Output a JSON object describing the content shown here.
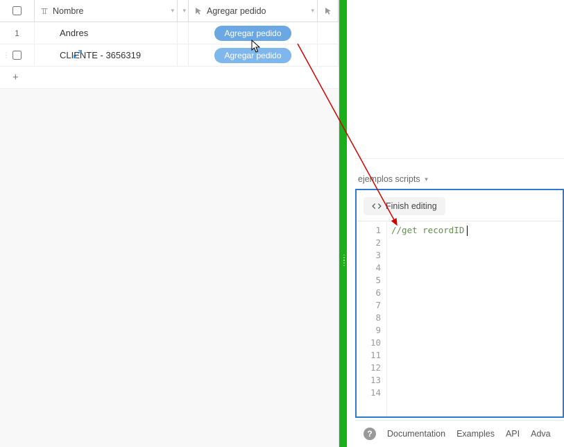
{
  "table": {
    "columns": {
      "nombre": "Nombre",
      "agregar": "Agregar pedido"
    },
    "rows": [
      {
        "num": "1",
        "nombre": "Andres",
        "button": "Agregar pedido",
        "expanded": false
      },
      {
        "num": "",
        "nombre": "CLIENTE - 3656319",
        "button": "Agregar pedido",
        "expanded": true
      }
    ],
    "add": "+"
  },
  "script": {
    "title": "ejemplos scripts",
    "finish_button": "Finish editing",
    "code": {
      "line1": "//get recordID"
    },
    "line_numbers": [
      "1",
      "2",
      "3",
      "4",
      "5",
      "6",
      "7",
      "8",
      "9",
      "10",
      "11",
      "12",
      "13",
      "14"
    ]
  },
  "footer": {
    "help": "?",
    "documentation": "Documentation",
    "examples": "Examples",
    "api": "API",
    "advanced": "Adva"
  }
}
